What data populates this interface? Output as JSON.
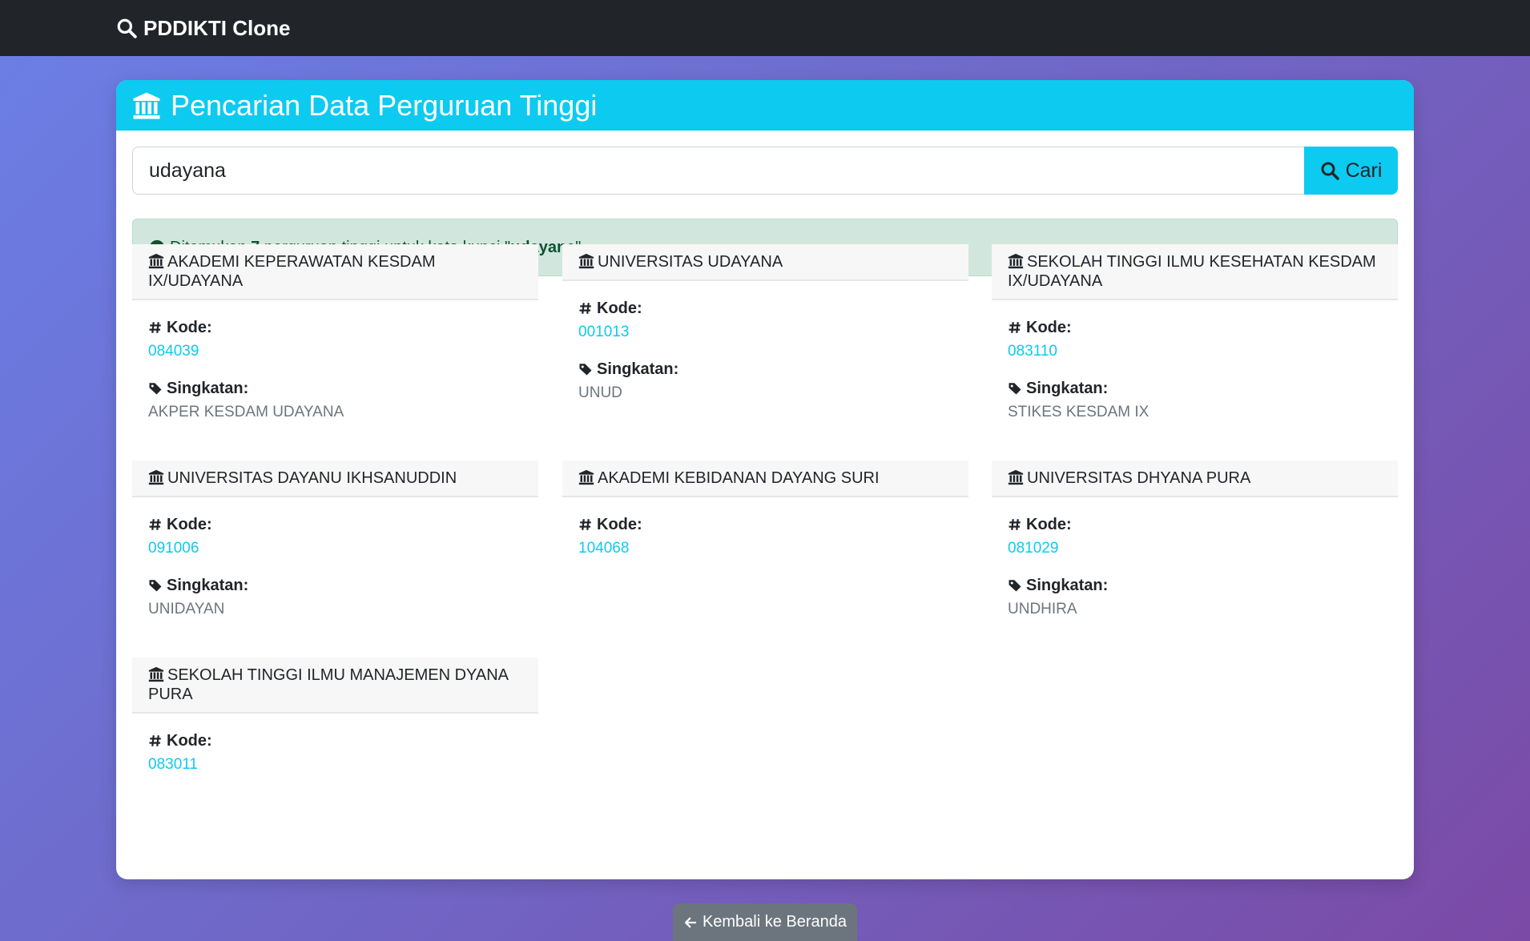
{
  "navbar": {
    "brand": "PDDIKTI Clone",
    "brand_icon": "search-icon"
  },
  "card": {
    "title": "Pencarian Data Perguruan Tinggi",
    "title_icon": "university-icon"
  },
  "search": {
    "value": "udayana",
    "button_label": "Cari"
  },
  "alert": {
    "prefix": "Ditemukan ",
    "count": "7",
    "middle": " perguruan tinggi untuk kata kunci \"",
    "keyword": "udayana",
    "suffix": "\""
  },
  "labels": {
    "kode": "Kode:",
    "singkatan": "Singkatan:"
  },
  "results": [
    {
      "name": "AKADEMI KEPERAWATAN KESDAM IX/UDAYANA",
      "kode": "084039",
      "singkatan": "AKPER KESDAM UDAYANA"
    },
    {
      "name": "UNIVERSITAS UDAYANA",
      "kode": "001013",
      "singkatan": "UNUD"
    },
    {
      "name": "SEKOLAH TINGGI ILMU KESEHATAN KESDAM IX/UDAYANA",
      "kode": "083110",
      "singkatan": "STIKES KESDAM IX"
    },
    {
      "name": "UNIVERSITAS DAYANU IKHSANUDDIN",
      "kode": "091006",
      "singkatan": "UNIDAYAN"
    },
    {
      "name": "AKADEMI KEBIDANAN DAYANG SURI",
      "kode": "104068",
      "singkatan": ""
    },
    {
      "name": "UNIVERSITAS DHYANA PURA",
      "kode": "081029",
      "singkatan": "UNDHIRA"
    },
    {
      "name": "SEKOLAH TINGGI ILMU MANAJEMEN DYANA PURA",
      "kode": "083011",
      "singkatan": ""
    }
  ],
  "back": {
    "label": "Kembali ke Beranda"
  }
}
